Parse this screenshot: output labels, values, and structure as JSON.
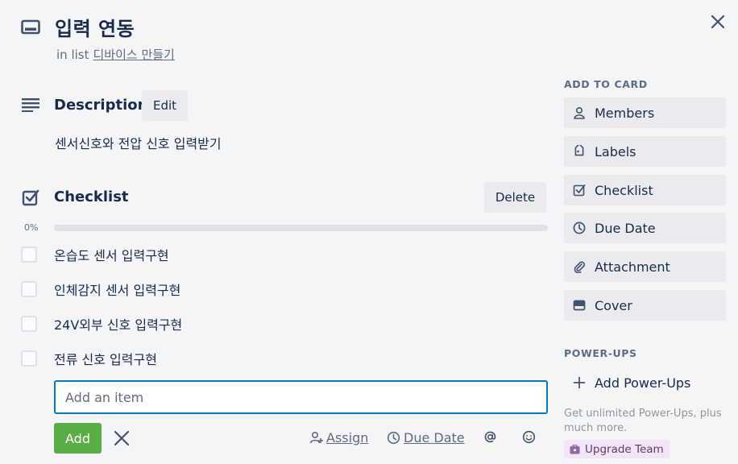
{
  "card": {
    "title": "입력 연동",
    "in_list_prefix": "in list",
    "list_name": "디바이스 만들기"
  },
  "description": {
    "title": "Description",
    "edit_label": "Edit",
    "text": "센서신호와 전압 신호 입력받기"
  },
  "checklist": {
    "title": "Checklist",
    "delete_label": "Delete",
    "percent_label": "0%",
    "progress": 0,
    "items": [
      {
        "text": "온습도 센서 입력구현",
        "checked": false
      },
      {
        "text": "인체감지 센서 입력구현",
        "checked": false
      },
      {
        "text": "24V외부 신호 입력구현",
        "checked": false
      },
      {
        "text": "전류 신호 입력구현",
        "checked": false
      }
    ],
    "add_placeholder": "Add an item",
    "add_value": "",
    "add_button": "Add",
    "assign_label": "Assign",
    "due_date_label": "Due Date"
  },
  "sidebar": {
    "add_to_card_heading": "ADD TO CARD",
    "buttons": [
      {
        "label": "Members",
        "icon": "person-icon"
      },
      {
        "label": "Labels",
        "icon": "tag-icon"
      },
      {
        "label": "Checklist",
        "icon": "checkbox-icon"
      },
      {
        "label": "Due Date",
        "icon": "clock-icon"
      },
      {
        "label": "Attachment",
        "icon": "paperclip-icon"
      },
      {
        "label": "Cover",
        "icon": "cover-icon"
      }
    ],
    "powerups_heading": "POWER-UPS",
    "add_powerups_label": "Add Power-Ups",
    "powerups_note": "Get unlimited Power-Ups, plus much more.",
    "upgrade_label": "Upgrade Team"
  },
  "colors": {
    "accent_blue": "#0079bf",
    "add_green": "#5aac44",
    "progress_track": "#dfe1e6",
    "upgrade_bg": "#f3e4f7"
  }
}
